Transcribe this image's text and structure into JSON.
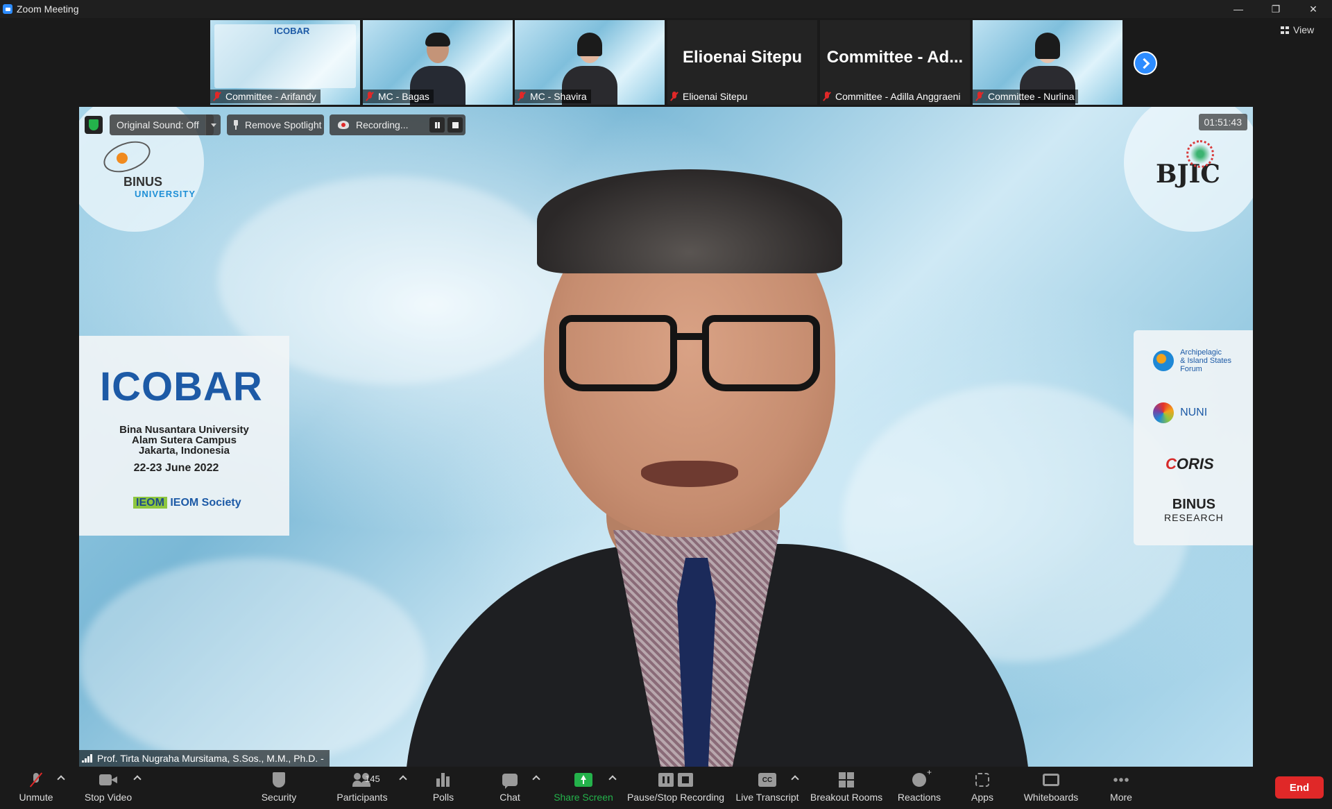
{
  "window": {
    "title": "Zoom Meeting",
    "minimize": "—",
    "restore": "❐",
    "close": "✕"
  },
  "view_button": {
    "label": "View"
  },
  "gallery": {
    "tiles": [
      {
        "name": "Committee - Arifandy",
        "has_video": true,
        "content": "poster"
      },
      {
        "name": "MC - Bagas",
        "has_video": true,
        "content": "person"
      },
      {
        "name": "MC - Shavira",
        "has_video": true,
        "content": "person"
      },
      {
        "name": "Elioenai Sitepu",
        "display_name": "Elioenai Sitepu",
        "has_video": false
      },
      {
        "name": "Committee - Adilla Anggraeni",
        "display_name": "Committee - Ad...",
        "has_video": false
      },
      {
        "name": "Committee - Nurlina",
        "has_video": true,
        "content": "person"
      }
    ]
  },
  "stage": {
    "original_sound": "Original Sound: Off",
    "remove_spotlight": "Remove Spotlight",
    "recording": "Recording...",
    "timer": "01:51:43",
    "speaker_name": "Prof. Tirta Nugraha Mursitama, S.Sos., M.M., Ph.D. -",
    "background": {
      "binus_logo": {
        "line1": "BINUS",
        "line2": "UNIVERSITY"
      },
      "bjic_logo": "BJIC",
      "icobar_card": {
        "title": "ICOBAR",
        "venue_line1": "Bina Nusantara University",
        "venue_line2": "Alam Sutera Campus",
        "venue_line3": "Jakarta, Indonesia",
        "date": "22-23 June 2022",
        "ieom_mark": "IEOM",
        "ieom_text": "IEOM Society"
      },
      "partners": {
        "archipelagic_line1": "Archipelagic",
        "archipelagic_line2": "& Island States",
        "archipelagic_line3": "Forum",
        "nuni": "NUNI",
        "coris_c": "C",
        "coris_rest": "ORIS",
        "binus_research_line1": "BINUS",
        "binus_research_line2": "RESEARCH"
      }
    }
  },
  "toolbar": {
    "unmute": "Unmute",
    "stop_video": "Stop Video",
    "security": "Security",
    "participants": "Participants",
    "participant_count": "145",
    "polls": "Polls",
    "chat": "Chat",
    "share_screen": "Share Screen",
    "pause_stop_recording": "Pause/Stop Recording",
    "live_transcript": "Live Transcript",
    "cc": "CC",
    "breakout_rooms": "Breakout Rooms",
    "reactions": "Reactions",
    "apps": "Apps",
    "whiteboards": "Whiteboards",
    "more": "More",
    "end": "End"
  },
  "colors": {
    "accent_blue": "#2d8cff",
    "share_green": "#24b24b",
    "end_red": "#e02828",
    "muted_red": "#e02828"
  }
}
